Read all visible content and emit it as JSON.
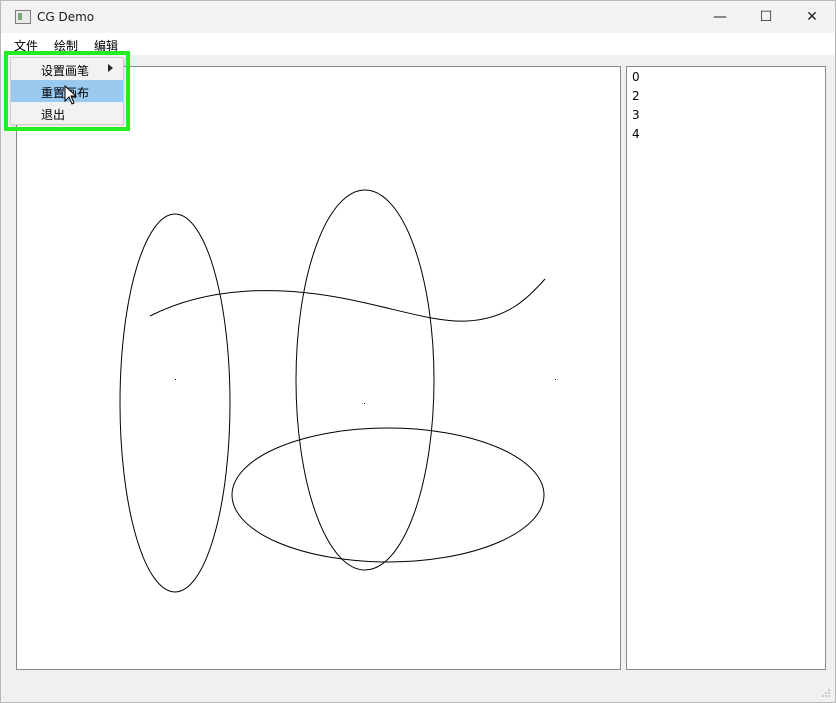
{
  "window": {
    "title": "CG Demo",
    "controls": {
      "minimize": "—",
      "maximize": "☐",
      "close": "✕"
    }
  },
  "menubar": {
    "items": [
      {
        "label": "文件"
      },
      {
        "label": "绘制"
      },
      {
        "label": "编辑"
      }
    ]
  },
  "dropdown": {
    "items": [
      {
        "label": "设置画笔",
        "submenu": true
      },
      {
        "label": "重置画布",
        "highlighted": true
      },
      {
        "label": "退出"
      }
    ]
  },
  "item_list": [
    "0",
    "2",
    "3",
    "4"
  ],
  "colors": {
    "highlight_box": "#22ee22",
    "menu_highlight": "#99c9ef",
    "stroke": "#000000"
  },
  "icons": {
    "app": "app-window-icon",
    "cursor": "mouse-pointer-icon",
    "submenu": "submenu-arrow-icon",
    "grip": "resize-grip-icon"
  }
}
